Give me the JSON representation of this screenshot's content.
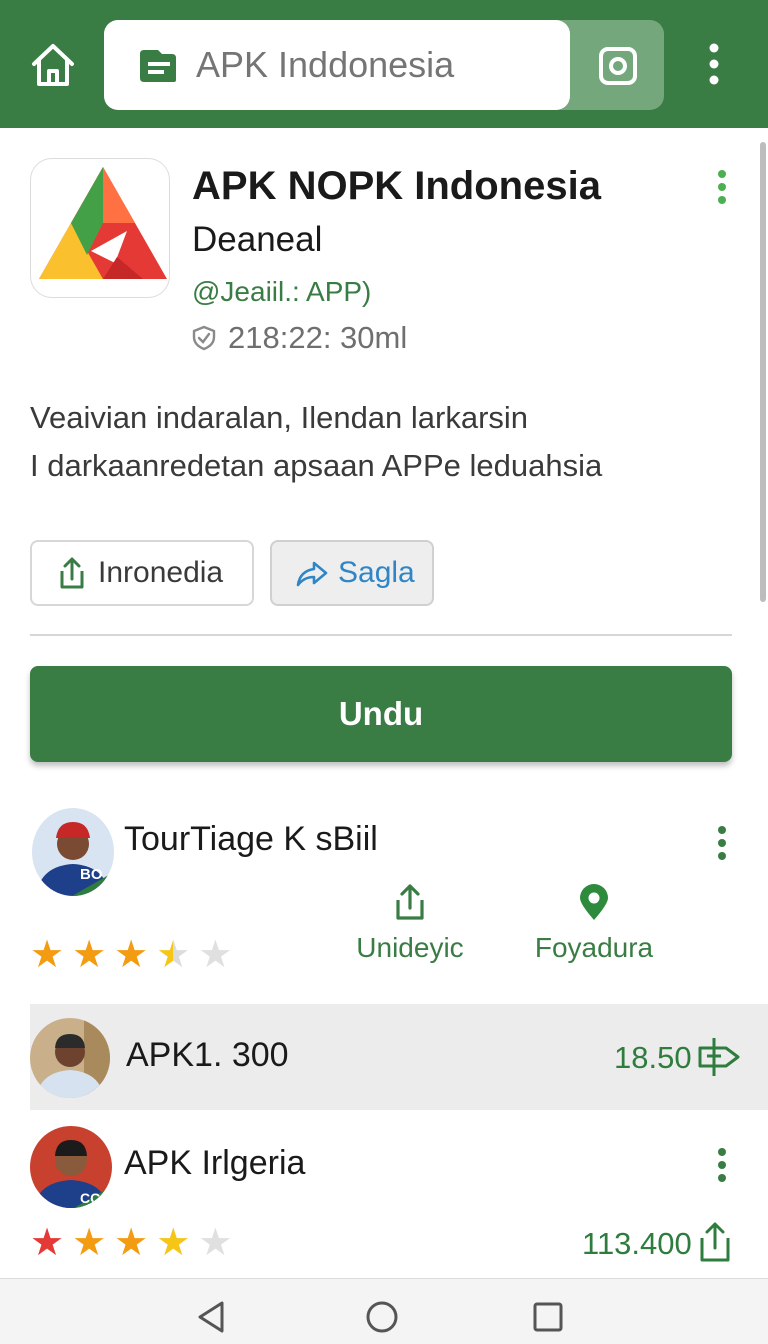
{
  "search": {
    "placeholder": "APK Inddonesia"
  },
  "app": {
    "title": "APK NOPK Indonesia",
    "developer": "Deaneal",
    "category": "@Jeaiil.: APP)",
    "meta": "218:22: 30ml",
    "description_lines": [
      "Veaivian indaralan, Ilendan larkarsin",
      "I darkaanredetan apsaan APPe leduahsia"
    ]
  },
  "chips": {
    "share": "Inronedia",
    "sagla": "Sagla"
  },
  "download": {
    "label": "Undu"
  },
  "list": [
    {
      "title": "TourTiage K sBiil",
      "badge": "BO",
      "rating": 3.5,
      "actions": [
        {
          "icon": "share-icon",
          "label": "Unideyic"
        },
        {
          "icon": "location-pin-icon",
          "label": "Foyadura"
        }
      ]
    },
    {
      "title": "APK1. 300",
      "value": "18.50"
    },
    {
      "title": "APK Irlgeria",
      "badge": "CC",
      "rating": 3.5,
      "value": "113.400"
    }
  ],
  "colors": {
    "primary": "#3a7d44",
    "star": "#f5a623",
    "link": "#2f86c6"
  }
}
